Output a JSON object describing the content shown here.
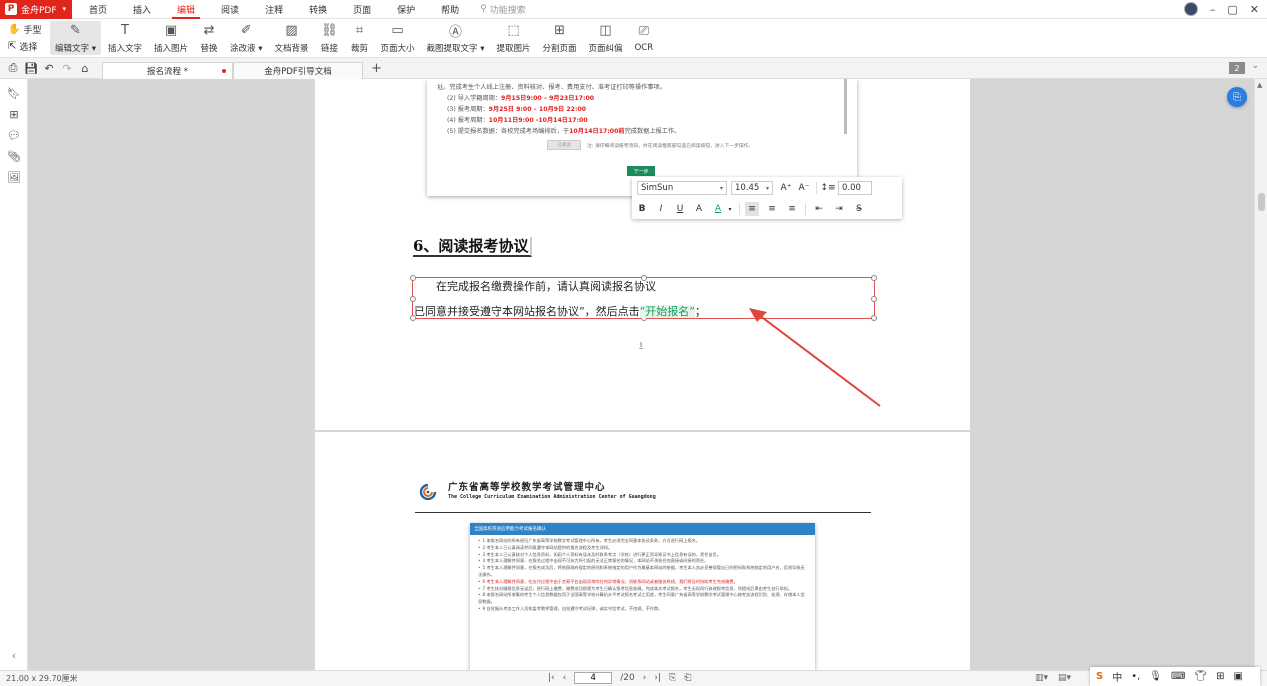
{
  "app": {
    "name": "金舟PDF"
  },
  "menu": {
    "items": [
      "首页",
      "插入",
      "编辑",
      "阅读",
      "注释",
      "转换",
      "页面",
      "保护",
      "帮助"
    ],
    "active_index": 2,
    "search_placeholder": "功能搜索"
  },
  "ribbon": {
    "hand_label": "手型",
    "select_label": "选择",
    "tools": [
      {
        "label": "编辑文字 ▾",
        "icon": "edit-text-icon",
        "glyph": "✎",
        "active": true
      },
      {
        "label": "插入文字",
        "icon": "insert-text-icon",
        "glyph": "T"
      },
      {
        "label": "插入图片",
        "icon": "insert-image-icon",
        "glyph": "▣"
      },
      {
        "label": "替换",
        "icon": "replace-icon",
        "glyph": "⇄"
      },
      {
        "label": "涂改液 ▾",
        "icon": "correction-fluid-icon",
        "glyph": "✐"
      },
      {
        "label": "文档背景",
        "icon": "document-background-icon",
        "glyph": "▨"
      },
      {
        "label": "链接",
        "icon": "link-icon",
        "glyph": "⛓"
      },
      {
        "label": "裁剪",
        "icon": "crop-icon",
        "glyph": "⌗"
      },
      {
        "label": "页面大小",
        "icon": "page-size-icon",
        "glyph": "▭"
      },
      {
        "label": "截图提取文字 ▾",
        "icon": "screenshot-ocr-icon",
        "glyph": "Ⓐ"
      },
      {
        "label": "提取图片",
        "icon": "extract-image-icon",
        "glyph": "⬚"
      },
      {
        "label": "分割页面",
        "icon": "split-page-icon",
        "glyph": "⊞"
      },
      {
        "label": "页面纠偏",
        "icon": "deskew-icon",
        "glyph": "◫"
      },
      {
        "label": "OCR",
        "icon": "ocr-icon",
        "glyph": "⎚"
      }
    ]
  },
  "tabs": {
    "items": [
      {
        "label": "报名流程 *",
        "active": true,
        "modified": true
      },
      {
        "label": "金舟PDF引导文档",
        "active": false,
        "modified": false
      }
    ],
    "page_badge": "2"
  },
  "page1": {
    "shot_lines": [
      {
        "text": "址。完成考生个人线上注册、资料核对、报考、费用支付、准考证打印等操作事项。",
        "red": ""
      },
      {
        "text": "(2) 导入学籍周期：",
        "red": "9月15日9:00 – 9月23日17:00"
      },
      {
        "text": "(3) 报考周期：",
        "red": "9月25日 9:00 – 10月9日 22:00"
      },
      {
        "text": "(4) 报考周期：",
        "red": "10月11日9:00 -10月14日17:00"
      },
      {
        "text": "(5) 提交报名数据：各校完成考场编排后，于",
        "red": "10月14日17:00前",
        "tail": "完成数据上报工作。"
      }
    ],
    "shot_check_box": "已阅读",
    "shot_check_text": "注: 请仔细阅读报考须知，并在阅读框底部勾选已阅读按钮，进入下一步操作。",
    "shot_next": "下一步",
    "heading": "6、阅读报考协议",
    "para_line1": "在完成报名缴费操作前，请认真阅读报名协议",
    "para_line2_prefix": "已同意并接受遵守本网站报名协议”，然后点击",
    "para_line2_hl": "“开始报名”",
    "para_line2_suffix": "；"
  },
  "format_toolbar": {
    "font": "SimSun",
    "size": "10.45",
    "line_spacing": "0.00"
  },
  "page2": {
    "org_title": "广东省高等学校教学考试管理中心",
    "org_sub": "The College Curriculum Examination Administration Center of Guangdong",
    "shot_bar": "全国高校英语应用能力考试报名确认",
    "items": [
      {
        "text": "1 本报名网站的所有权归广东省高等学校教学考试管理中心所有。考生必须完全同意本协议条款，方可进行网上报名。",
        "red": false
      },
      {
        "text": "2 考生本人已认真阅读并同意遵守本网站提供的报名流程及考生须知。",
        "red": false
      },
      {
        "text": "3 考生本人已认真核对个人信息资料，如因个人资料有误未及时联系考点（学校）进行更正而导致证书上信息有误的，责任自负。",
        "red": false
      },
      {
        "text": "4 考生本人理解并同意，在报名过程中出现不可抗力所引起的无法正常报名的情况，本网站不承担任何直接或间接的责任。",
        "red": false
      },
      {
        "text": "5 考生本人理解并同意，在报名成功后，将依照政府规定的原则和系统指定的用户作为最基本网站的依据，考生本人务必妥善保管自己的密码和系统指定的用户名，否则导致无法操作。",
        "red": false
      },
      {
        "text": "6 考生本人理解并同意，在支付过程中由于交易平台出现异常的任何异常情况，须联系网站或者服务热线，我们将及时协助考生完成缴费。",
        "red": true
      },
      {
        "text": "7 考生核对确报信息无误后，进行网上缴费，缴费成功即视为考生已确认报考信息准确，完成本次考试报名，考生无权再行修改报考信息，所提成后果由考生自行承担。",
        "red": false
      },
      {
        "text": "8 本报名网站所收集的考生个人信息数据仅用于全国高等学校计算机水平考试报名考试之用途，考生同意广东省高等学校教学考试管理中心按考务流程识别、处理、存储本人信息数据。",
        "red": false
      },
      {
        "text": "9 自觉服从考务工作人员和监考教师管理，自觉遵守考试纪律，诚实守信考试，不违规，不作弊。",
        "red": false
      }
    ]
  },
  "status": {
    "page_size": "21.00 x 29.70厘米",
    "current_page": "4",
    "total_pages": "/20"
  },
  "ime": {
    "lang": "中"
  }
}
